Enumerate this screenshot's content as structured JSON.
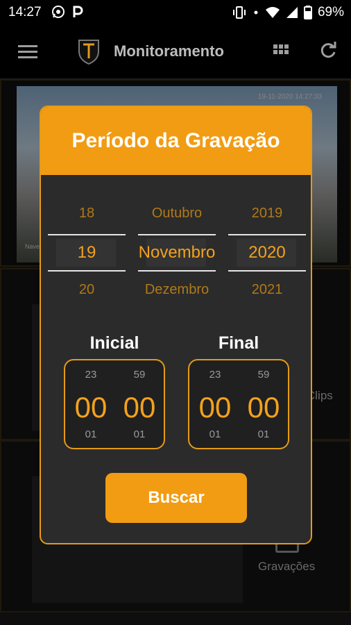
{
  "status_bar": {
    "time": "14:27",
    "battery": "69%",
    "left_icons": [
      "whatsapp-icon",
      "parking-p-icon"
    ],
    "right_icons": [
      "vibrate-icon",
      "dots-icon",
      "wifi-icon",
      "signal-icon",
      "battery-icon"
    ]
  },
  "app_bar": {
    "title": "Monitoramento",
    "icons": [
      "menu-icon",
      "logo-icon",
      "grid-icon",
      "refresh-icon"
    ]
  },
  "background": {
    "camera_timestamp": "19-11-2020 14:27:33",
    "camera_label": "Nave",
    "row2_label": "Clips",
    "row3_label": "Gravações"
  },
  "dialog": {
    "title": "Período da Gravação",
    "date_picker": {
      "day": {
        "prev": "18",
        "selected": "19",
        "next": "20"
      },
      "month": {
        "prev": "Outubro",
        "selected": "Novembro",
        "next": "Dezembro"
      },
      "year": {
        "prev": "2019",
        "selected": "2020",
        "next": "2021"
      }
    },
    "initial": {
      "label": "Inicial",
      "hour": {
        "prev": "23",
        "current": "00",
        "next": "01"
      },
      "minute": {
        "prev": "59",
        "current": "00",
        "next": "01"
      }
    },
    "final": {
      "label": "Final",
      "hour": {
        "prev": "23",
        "current": "00",
        "next": "01"
      },
      "minute": {
        "prev": "59",
        "current": "00",
        "next": "01"
      }
    },
    "search_button": "Buscar"
  },
  "colors": {
    "accent": "#f19c13",
    "dialog_bg": "#2b2b2b",
    "picker_text": "#f3a21d"
  }
}
